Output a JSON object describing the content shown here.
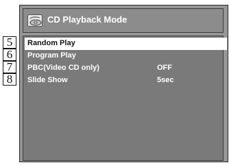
{
  "title": "CD Playback Mode",
  "callouts": [
    "5",
    "6",
    "7",
    "8"
  ],
  "menu": [
    {
      "label": "Random Play",
      "value": "",
      "selected": true
    },
    {
      "label": "Program Play",
      "value": "",
      "selected": false
    },
    {
      "label": "PBC(Video CD only)",
      "value": "OFF",
      "selected": false
    },
    {
      "label": "Slide Show",
      "value": "5sec",
      "selected": false
    }
  ],
  "colors": {
    "panel": "#969696",
    "list": "#7a7a7a",
    "highlight": "#ffffff",
    "text": "#ffffff"
  },
  "icons": {
    "title": "disc-icon"
  }
}
